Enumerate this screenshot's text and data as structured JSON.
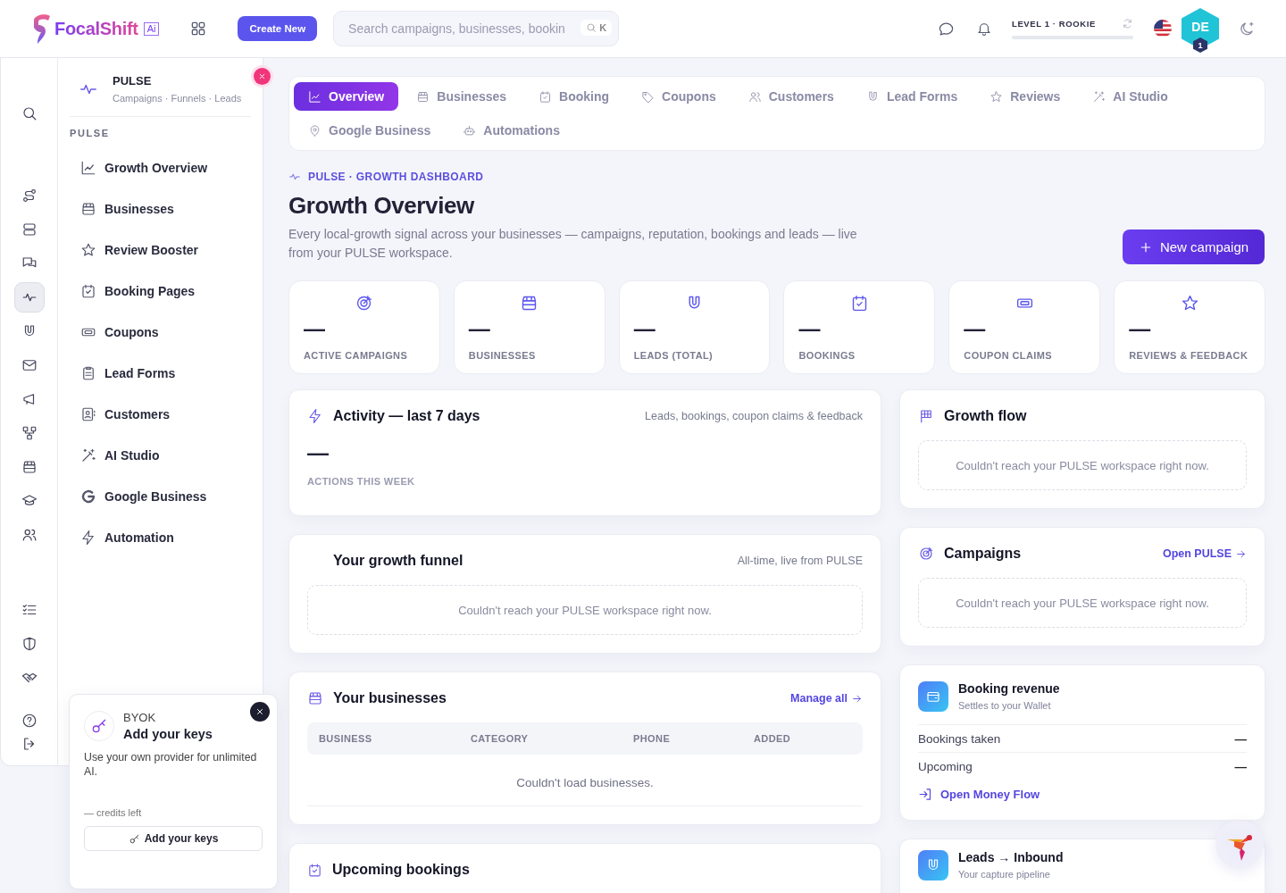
{
  "header": {
    "logo": "FocalShift",
    "logo_badge": "Ai",
    "create_button": "Create New",
    "search": {
      "placeholder": "Search campaigns, businesses, bookin",
      "shortcut": "K"
    },
    "level": {
      "label": "LEVEL 1 · ROOKIE",
      "level": 0
    },
    "avatar": {
      "initials": "DE",
      "badge": "1"
    }
  },
  "rail": {
    "items": [
      {
        "selected": false
      },
      {
        "selected": false
      },
      {
        "selected": false
      },
      {
        "selected": false
      },
      {
        "selected": true
      },
      {
        "selected": false
      },
      {
        "selected": false
      },
      {
        "selected": false
      },
      {
        "selected": false
      },
      {
        "selected": false
      },
      {
        "selected": false
      },
      {
        "selected": false
      },
      {
        "selected": false
      },
      {
        "selected": false
      },
      {
        "selected": false
      },
      {
        "selected": false
      },
      {
        "selected": false
      }
    ]
  },
  "sidebar": {
    "title": "PULSE",
    "subtitle": "Campaigns · Funnels · Leads",
    "section": "PULSE",
    "items": [
      {
        "label": "Growth Overview"
      },
      {
        "label": "Businesses"
      },
      {
        "label": "Review Booster"
      },
      {
        "label": "Booking Pages"
      },
      {
        "label": "Coupons"
      },
      {
        "label": "Lead Forms"
      },
      {
        "label": "Customers"
      },
      {
        "label": "AI Studio"
      },
      {
        "label": "Google Business"
      },
      {
        "label": "Automation"
      }
    ]
  },
  "byok": {
    "eyebrow": "BYOK",
    "title": "Add your keys",
    "text": "Use your own provider for unlimited AI.",
    "credits": "— credits left",
    "button": "Add your keys"
  },
  "tabs": [
    {
      "label": "Overview",
      "selected": true
    },
    {
      "label": "Businesses",
      "selected": false
    },
    {
      "label": "Booking",
      "selected": false
    },
    {
      "label": "Coupons",
      "selected": false
    },
    {
      "label": "Customers",
      "selected": false
    },
    {
      "label": "Lead Forms",
      "selected": false
    },
    {
      "label": "Reviews",
      "selected": false
    },
    {
      "label": "AI Studio",
      "selected": false
    },
    {
      "label": "Google Business",
      "selected": false
    },
    {
      "label": "Automations",
      "selected": false
    }
  ],
  "page": {
    "eyebrow": "PULSE · GROWTH DASHBOARD",
    "title": "Growth Overview",
    "description": "Every local-growth signal across your businesses — campaigns, reputation, bookings and leads — live from your PULSE workspace.",
    "action": "New campaign"
  },
  "stats": [
    {
      "value": "—",
      "label": "ACTIVE CAMPAIGNS"
    },
    {
      "value": "—",
      "label": "BUSINESSES"
    },
    {
      "value": "—",
      "label": "LEADS (TOTAL)"
    },
    {
      "value": "—",
      "label": "BOOKINGS"
    },
    {
      "value": "—",
      "label": "COUPON CLAIMS"
    },
    {
      "value": "—",
      "label": "REVIEWS & FEEDBACK"
    }
  ],
  "activity": {
    "title": "Activity — last 7 days",
    "note": "Leads, bookings, coupon claims & feedback",
    "value": "—",
    "label": "ACTIONS THIS WEEK"
  },
  "funnel": {
    "title": "Your growth funnel",
    "note": "All-time, live from PULSE",
    "empty": "Couldn't reach your PULSE workspace right now."
  },
  "businesses": {
    "title": "Your businesses",
    "link": "Manage all",
    "columns": [
      "BUSINESS",
      "CATEGORY",
      "PHONE",
      "ADDED"
    ],
    "empty": "Couldn't load businesses."
  },
  "upcoming": {
    "title": "Upcoming bookings"
  },
  "growth_flow": {
    "title": "Growth flow",
    "empty": "Couldn't reach your PULSE workspace right now."
  },
  "campaigns": {
    "title": "Campaigns",
    "link": "Open PULSE",
    "empty": "Couldn't reach your PULSE workspace right now."
  },
  "booking_revenue": {
    "title": "Booking revenue",
    "subtitle": "Settles to your Wallet",
    "rows": [
      {
        "label": "Bookings taken",
        "value": "—"
      },
      {
        "label": "Upcoming",
        "value": "—"
      }
    ],
    "link": "Open Money Flow"
  },
  "leads_inbound": {
    "title": "Leads → Inbound",
    "subtitle": "Your capture pipeline"
  }
}
